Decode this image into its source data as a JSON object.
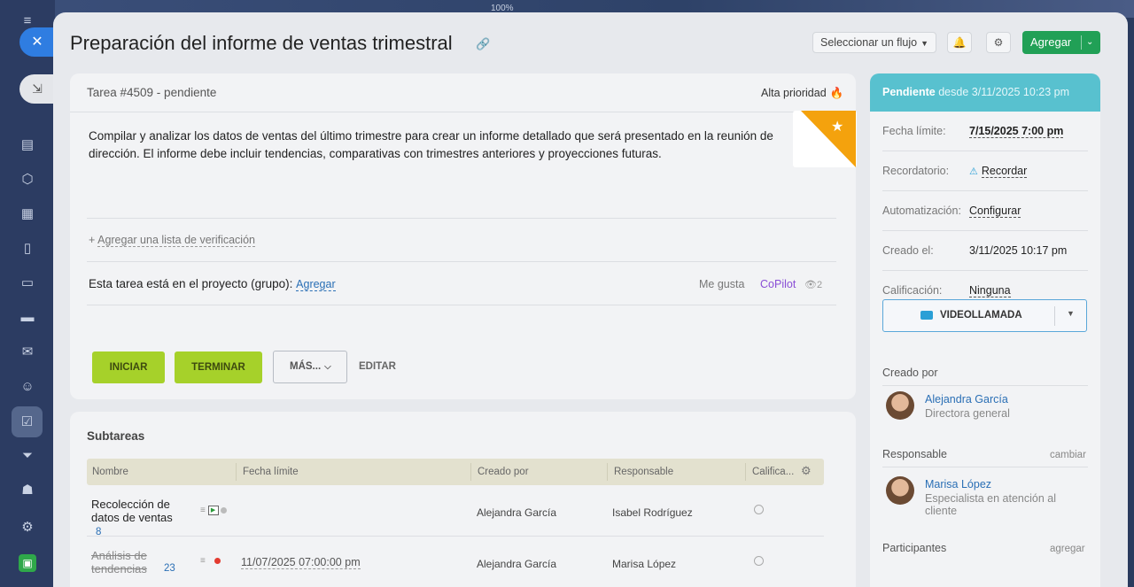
{
  "zoom": "100%",
  "task": {
    "title": "Preparación del informe de ventas trimestral",
    "flow_select": "Seleccionar un flujo",
    "add_label": "Agregar",
    "id_status": "Tarea #4509 - pendiente",
    "priority": "Alta prioridad",
    "description": "Compilar y analizar los datos de ventas del último trimestre para crear un informe detallado que será presentado en la reunión de dirección. El informe debe incluir tendencias, comparativas con trimestres anteriores y proyecciones futuras.",
    "checklist_plus": "+",
    "checklist_link": "Agregar una lista de verificación",
    "project_text": "Esta tarea está en el proyecto (grupo):",
    "project_link": "Agregar",
    "like": "Me gusta",
    "copilot": "CoPilot",
    "views": "2",
    "buttons": {
      "start": "INICIAR",
      "finish": "TERMINAR",
      "more": "MÁS...",
      "edit": "EDITAR"
    }
  },
  "subtasks": {
    "title": "Subtareas",
    "columns": [
      "Nombre",
      "Fecha límite",
      "Creado por",
      "Responsable",
      "Califica..."
    ],
    "rows": [
      {
        "name": "Recolección de datos de ventas",
        "count": "8",
        "deadline": "",
        "creator": "Alejandra García",
        "responsible": "Isabel Rodríguez"
      },
      {
        "name": "Análisis de tendencias",
        "count": "23",
        "deadline": "11/07/2025     07:00:00 pm",
        "creator": "Alejandra García",
        "responsible": "Marisa López"
      }
    ]
  },
  "sidebar": {
    "status": "Pendiente",
    "since": "desde 3/11/2025 10:23 pm",
    "fields": {
      "deadline_label": "Fecha límite:",
      "deadline_value": "7/15/2025 7:00 pm",
      "reminder_label": "Recordatorio:",
      "reminder_value": "Recordar",
      "automation_label": "Automatización:",
      "automation_value": "Configurar",
      "created_label": "Creado el:",
      "created_value": "3/11/2025 10:17 pm",
      "rating_label": "Calificación:",
      "rating_value": "Ninguna"
    },
    "video_call": "VIDEOLLAMADA",
    "created_by_title": "Creado por",
    "creator": {
      "name": "Alejandra García",
      "role": "Directora general"
    },
    "responsible_title": "Responsable",
    "responsible_action": "cambiar",
    "responsible": {
      "name": "Marisa López",
      "role": "Especialista en atención al cliente"
    },
    "participants_title": "Participantes",
    "participants_action": "agregar"
  },
  "colors": {
    "accent_green": "#21a056",
    "action_lime": "#a6d12a",
    "status_teal": "#58c1cf",
    "priority_fire": "#f07a1a",
    "link_blue": "#2a6fb5"
  }
}
